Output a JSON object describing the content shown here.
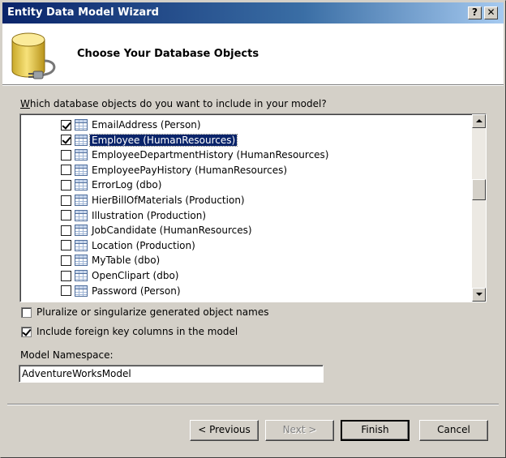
{
  "window": {
    "title": "Entity Data Model Wizard",
    "help_glyph": "?",
    "close_glyph": "✕"
  },
  "header": {
    "title": "Choose Your Database Objects",
    "icon": "database-icon"
  },
  "question": "Which database objects do you want to include in your model?",
  "objects": [
    {
      "label": "EmailAddress (Person)",
      "checked": true,
      "selected": false
    },
    {
      "label": "Employee (HumanResources)",
      "checked": true,
      "selected": true
    },
    {
      "label": "EmployeeDepartmentHistory (HumanResources)",
      "checked": false,
      "selected": false
    },
    {
      "label": "EmployeePayHistory (HumanResources)",
      "checked": false,
      "selected": false
    },
    {
      "label": "ErrorLog (dbo)",
      "checked": false,
      "selected": false
    },
    {
      "label": "HierBillOfMaterials (Production)",
      "checked": false,
      "selected": false
    },
    {
      "label": "Illustration (Production)",
      "checked": false,
      "selected": false
    },
    {
      "label": "JobCandidate (HumanResources)",
      "checked": false,
      "selected": false
    },
    {
      "label": "Location (Production)",
      "checked": false,
      "selected": false
    },
    {
      "label": "MyTable (dbo)",
      "checked": false,
      "selected": false
    },
    {
      "label": "OpenClipart (dbo)",
      "checked": false,
      "selected": false
    },
    {
      "label": "Password (Person)",
      "checked": false,
      "selected": false
    }
  ],
  "options": {
    "pluralize": {
      "label": "Pluralize or singularize generated object names",
      "checked": false
    },
    "foreign_keys": {
      "label": "Include foreign key columns in the model",
      "checked": true
    }
  },
  "namespace": {
    "label": "Model Namespace:",
    "value": "AdventureWorksModel"
  },
  "buttons": {
    "previous": "< Previous",
    "next": "Next >",
    "finish": "Finish",
    "cancel": "Cancel"
  }
}
